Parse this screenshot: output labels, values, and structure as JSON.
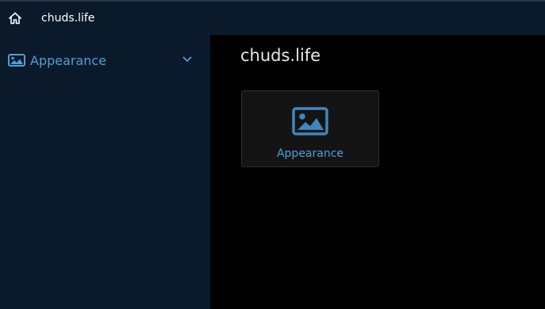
{
  "topbar": {
    "home_icon": "home-icon",
    "title": "chuds.life"
  },
  "sidebar": {
    "items": [
      {
        "icon": "image-icon",
        "label": "Appearance",
        "expand_icon": "chevron-down-icon"
      }
    ]
  },
  "main": {
    "title": "chuds.life",
    "tiles": [
      {
        "icon": "image-icon",
        "label": "Appearance"
      }
    ]
  },
  "colors": {
    "sidebar_bg": "#0b1a2a",
    "main_bg": "#000000",
    "accent": "#4d9fd8",
    "tile_bg": "#141414"
  }
}
